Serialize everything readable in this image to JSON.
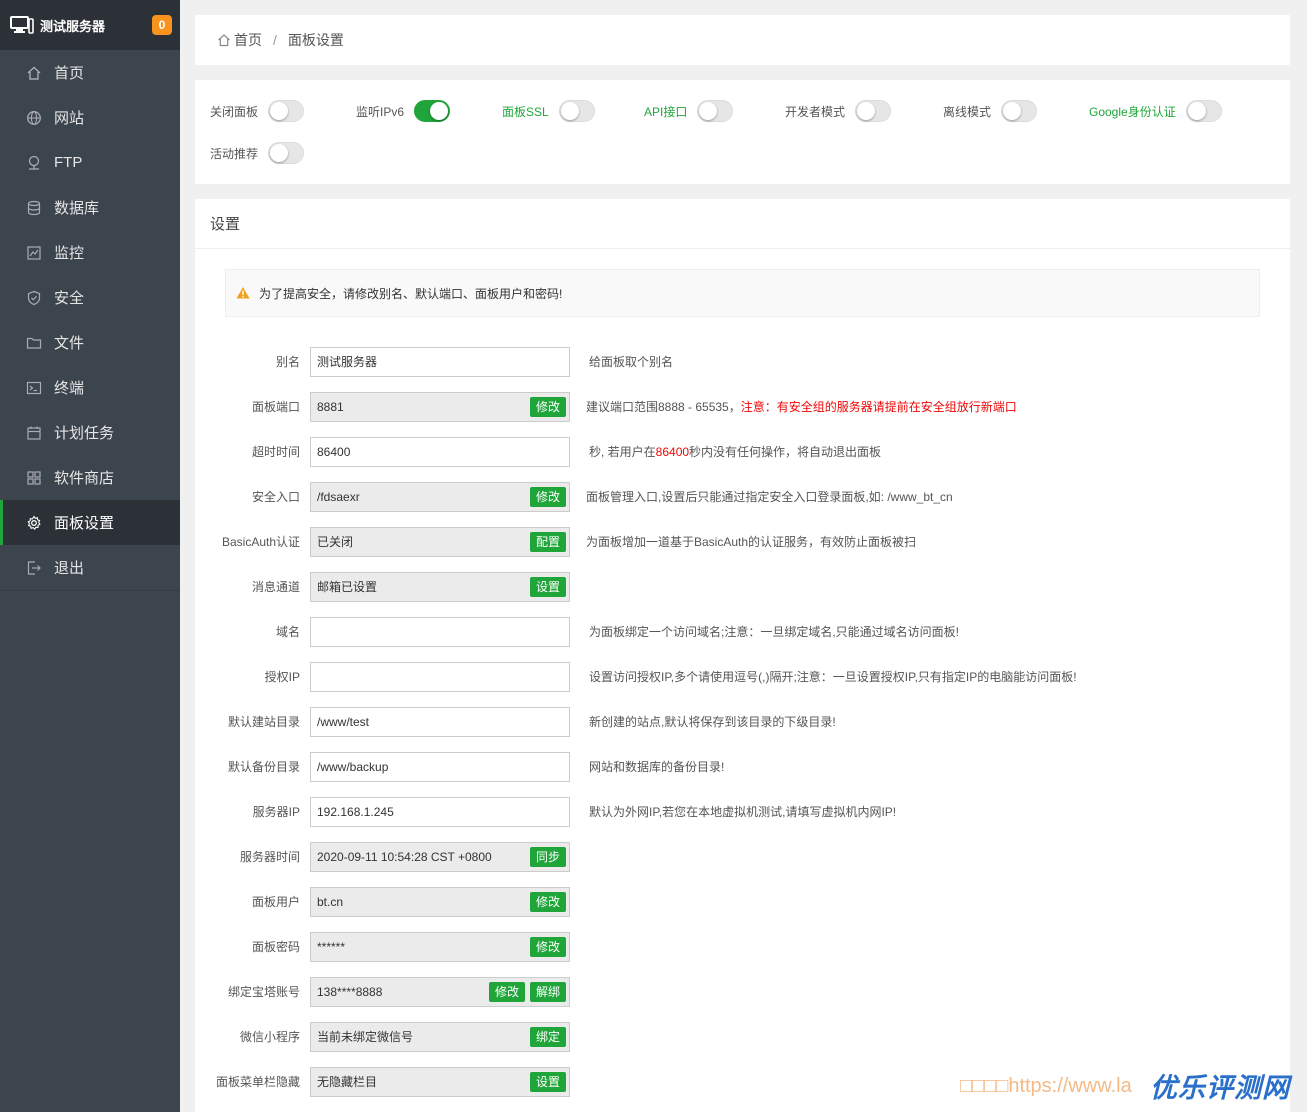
{
  "sidebar": {
    "server_name": "测试服务器",
    "badge": "0",
    "items": [
      {
        "label": "首页",
        "icon": "home-icon"
      },
      {
        "label": "网站",
        "icon": "globe-icon"
      },
      {
        "label": "FTP",
        "icon": "ftp-icon"
      },
      {
        "label": "数据库",
        "icon": "database-icon"
      },
      {
        "label": "监控",
        "icon": "monitor-chart-icon"
      },
      {
        "label": "安全",
        "icon": "shield-icon"
      },
      {
        "label": "文件",
        "icon": "folder-icon"
      },
      {
        "label": "终端",
        "icon": "terminal-icon"
      },
      {
        "label": "计划任务",
        "icon": "calendar-icon"
      },
      {
        "label": "软件商店",
        "icon": "apps-grid-icon"
      },
      {
        "label": "面板设置",
        "icon": "gear-icon",
        "active": true
      },
      {
        "label": "退出",
        "icon": "logout-icon"
      }
    ]
  },
  "breadcrumb": {
    "home": "首页",
    "sep": "/",
    "current": "面板设置"
  },
  "switches": [
    {
      "label": "关闭面板",
      "on": false,
      "green": false
    },
    {
      "label": "监听IPv6",
      "on": true,
      "green": false
    },
    {
      "label": "面板SSL",
      "on": false,
      "green": true
    },
    {
      "label": "API接口",
      "on": false,
      "green": true
    },
    {
      "label": "开发者模式",
      "on": false,
      "green": false
    },
    {
      "label": "离线模式",
      "on": false,
      "green": false
    },
    {
      "label": "Google身份认证",
      "on": false,
      "green": true
    },
    {
      "label": "活动推荐",
      "on": false,
      "green": false
    }
  ],
  "settings": {
    "title": "设置",
    "warning": "为了提高安全，请修改别名、默认端口、面板用户和密码!",
    "rows": {
      "alias": {
        "label": "别名",
        "value": "测试服务器",
        "hint": "给面板取个别名"
      },
      "port": {
        "label": "面板端口",
        "value": "8881",
        "btn": "修改",
        "hint": "建议端口范围8888 - 65535，",
        "hint_red": "注意：有安全组的服务器请提前在安全组放行新端口"
      },
      "timeout": {
        "label": "超时时间",
        "value": "86400",
        "hint_a": "秒, 若用户在",
        "hint_red": "86400",
        "hint_b": "秒内没有任何操作，将自动退出面板"
      },
      "entry": {
        "label": "安全入口",
        "value": "/fdsaexr",
        "btn": "修改",
        "hint": "面板管理入口,设置后只能通过指定安全入口登录面板,如: /www_bt_cn"
      },
      "basicauth": {
        "label": "BasicAuth认证",
        "value": "已关闭",
        "btn": "配置",
        "hint": "为面板增加一道基于BasicAuth的认证服务，有效防止面板被扫"
      },
      "message": {
        "label": "消息通道",
        "value": "邮箱已设置",
        "btn": "设置"
      },
      "domain": {
        "label": "域名",
        "value": "",
        "hint": "为面板绑定一个访问域名;注意：一旦绑定域名,只能通过域名访问面板!"
      },
      "authip": {
        "label": "授权IP",
        "value": "",
        "hint": "设置访问授权IP,多个请使用逗号(,)隔开;注意：一旦设置授权IP,只有指定IP的电脑能访问面板!"
      },
      "sitedir": {
        "label": "默认建站目录",
        "value": "/www/test",
        "hint": "新创建的站点,默认将保存到该目录的下级目录!"
      },
      "backupdir": {
        "label": "默认备份目录",
        "value": "/www/backup",
        "hint": "网站和数据库的备份目录!"
      },
      "serverip": {
        "label": "服务器IP",
        "value": "192.168.1.245",
        "hint": "默认为外网IP,若您在本地虚拟机测试,请填写虚拟机内网IP!"
      },
      "servertime": {
        "label": "服务器时间",
        "value": "2020-09-11 10:54:28 CST +0800",
        "btn": "同步"
      },
      "user": {
        "label": "面板用户",
        "value": "bt.cn",
        "btn": "修改"
      },
      "password": {
        "label": "面板密码",
        "value": "******",
        "btn": "修改"
      },
      "account": {
        "label": "绑定宝塔账号",
        "value": "138****8888",
        "btn": "修改",
        "btn2": "解绑"
      },
      "wechat": {
        "label": "微信小程序",
        "value": "当前未绑定微信号",
        "btn": "绑定"
      },
      "menuhide": {
        "label": "面板菜单栏隐藏",
        "value": "无隐藏栏目",
        "btn": "设置"
      }
    }
  },
  "watermark": {
    "url": "□□□□https://www.la",
    "logo": "优乐评测网"
  },
  "colors": {
    "sidebar": "#3c444d",
    "sidebar_dark": "#2c3138",
    "accent": "#20a53a",
    "badge": "#f7931e",
    "danger": "#ef0808"
  }
}
